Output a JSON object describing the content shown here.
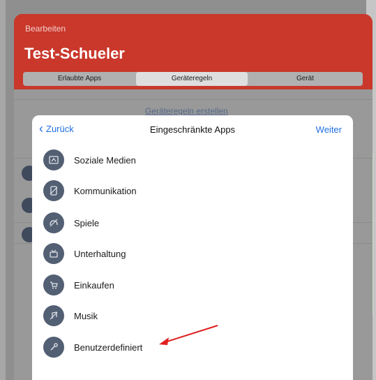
{
  "header": {
    "edit_label": "Bearbeiten",
    "profile_name": "Test-Schueler",
    "accent_color": "#c9382b"
  },
  "segments": [
    {
      "label": "Erlaubte Apps",
      "active": false
    },
    {
      "label": "Geräteregeln",
      "active": true
    },
    {
      "label": "Gerät",
      "active": false
    }
  ],
  "background": {
    "link_hint": "Geräteregeln erstellen"
  },
  "sheet": {
    "back_label": "Zurück",
    "title": "Eingeschränkte Apps",
    "next_label": "Weiter",
    "link_color": "#1f6fe0"
  },
  "categories": [
    {
      "label": "Soziale Medien",
      "icon": "social-media-icon"
    },
    {
      "label": "Kommunikation",
      "icon": "communication-icon"
    },
    {
      "label": "Spiele",
      "icon": "games-icon"
    },
    {
      "label": "Unterhaltung",
      "icon": "entertainment-icon"
    },
    {
      "label": "Einkaufen",
      "icon": "shopping-icon"
    },
    {
      "label": "Musik",
      "icon": "music-icon"
    },
    {
      "label": "Benutzerdefiniert",
      "icon": "custom-icon"
    }
  ],
  "annotation": {
    "color": "#e02020"
  }
}
